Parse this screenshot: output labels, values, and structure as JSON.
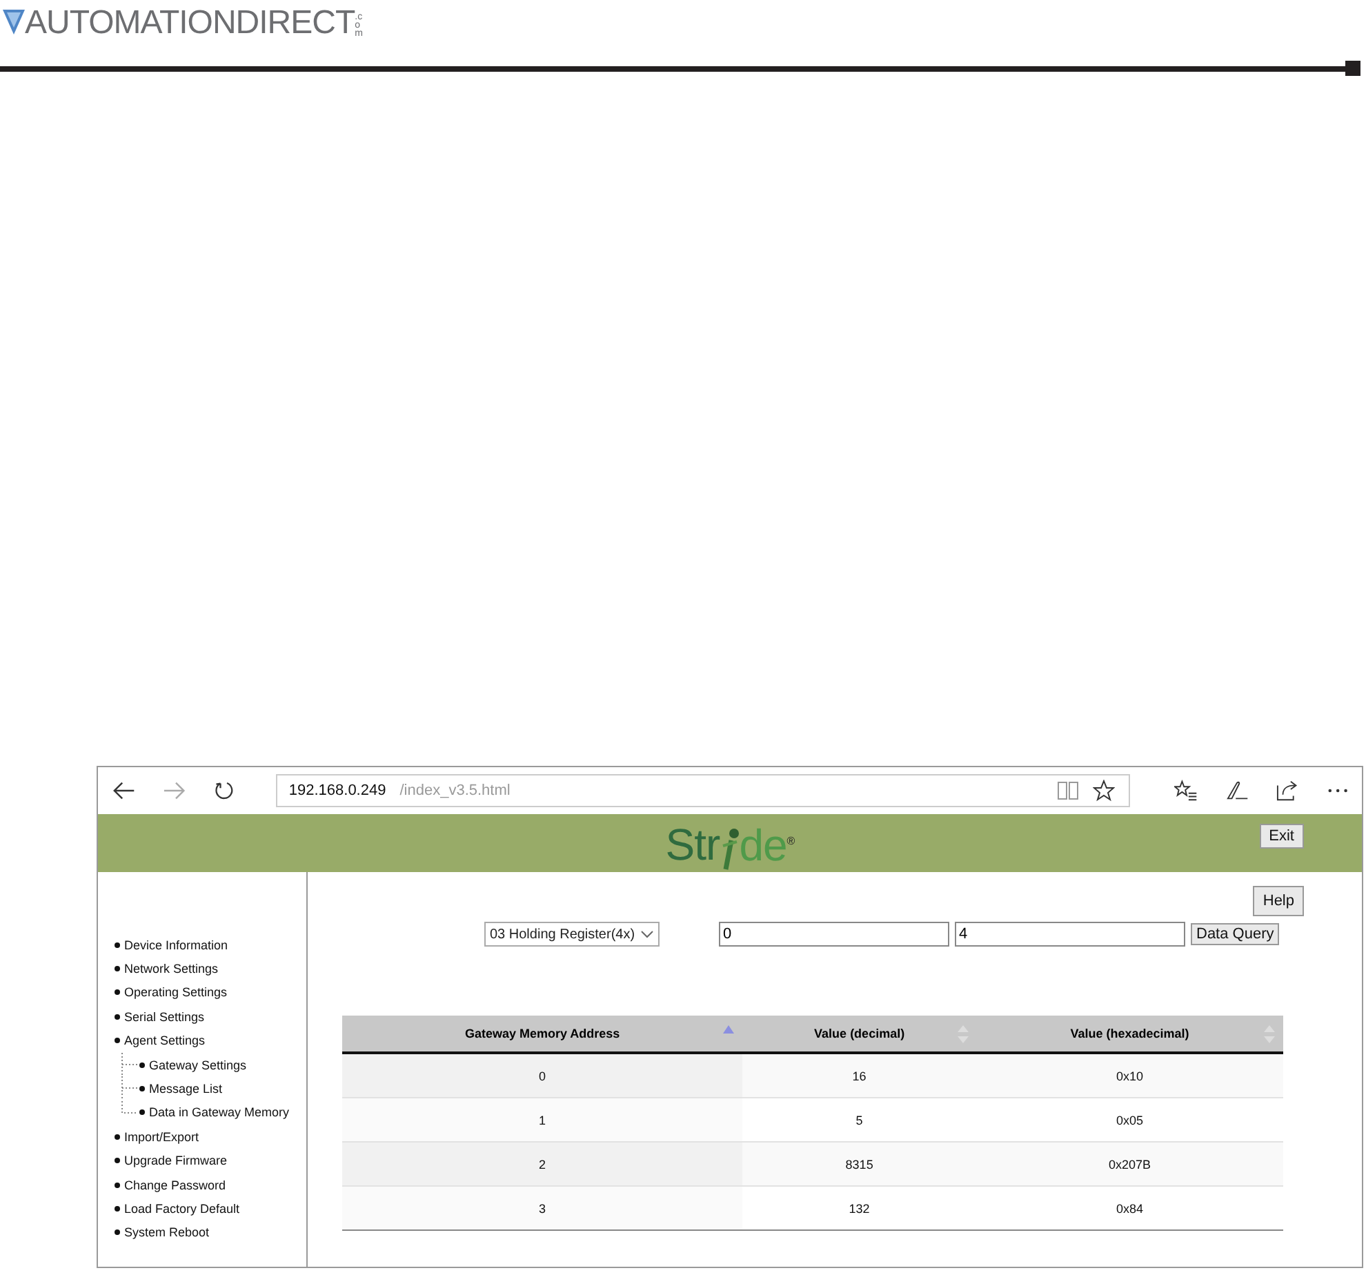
{
  "header": {
    "brand": "AUTOMATIONDIRECT",
    "brand_suffix": ".com"
  },
  "browser": {
    "url_host": "192.168.0.249",
    "url_path": "/index_v3.5.html"
  },
  "banner": {
    "logo": "Str",
    "logo_rest": "de$^{®}$",
    "exit_button": "Exit"
  },
  "sidebar": {
    "items": [
      {
        "label": "Device Information"
      },
      {
        "label": "Network Settings"
      },
      {
        "label": "Operating Settings"
      },
      {
        "label": "Serial Settings"
      },
      {
        "label": "Agent Settings",
        "children": [
          {
            "label": "Gateway Settings"
          },
          {
            "label": "Message List"
          },
          {
            "label": "Data in Gateway Memory"
          }
        ]
      },
      {
        "label": "Import/Export"
      },
      {
        "label": "Upgrade Firmware"
      },
      {
        "label": "Change Password"
      },
      {
        "label": "Load Factory Default"
      },
      {
        "label": "System Reboot"
      }
    ]
  },
  "main": {
    "help_button": "Help",
    "register_select": "03 Holding Register(4x)",
    "start_field": "0",
    "count_field": "4",
    "query_button": "Data Query"
  },
  "table": {
    "columns": [
      {
        "label": "Gateway Memory Address",
        "sorted": true
      },
      {
        "label": "Value (decimal)",
        "sorted": false
      },
      {
        "label": "Value (hexadecimal)",
        "sorted": false
      }
    ],
    "rows": [
      [
        "0",
        "16",
        "0x10"
      ],
      [
        "1",
        "5",
        "0x05"
      ],
      [
        "2",
        "8315",
        "0x207B"
      ],
      [
        "3",
        "132",
        "0x84"
      ]
    ]
  }
}
